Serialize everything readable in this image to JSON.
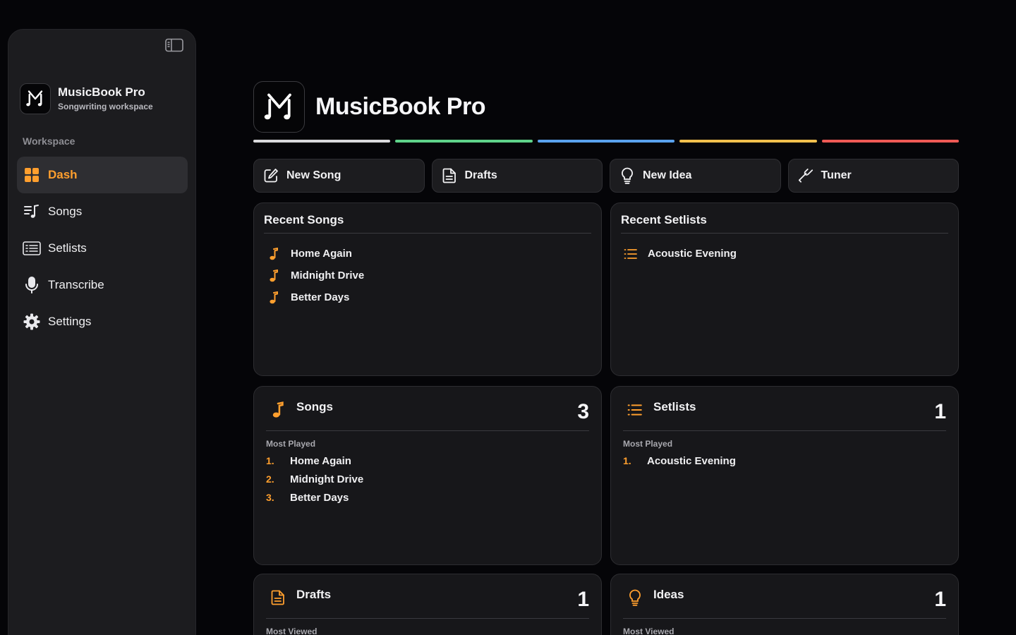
{
  "sidebar": {
    "brand_title": "MusicBook Pro",
    "brand_subtitle": "Songwriting workspace",
    "section_label": "Workspace",
    "items": [
      {
        "label": "Dash",
        "icon": "grid-icon",
        "active": true
      },
      {
        "label": "Songs",
        "icon": "music-list-icon"
      },
      {
        "label": "Setlists",
        "icon": "list-box-icon"
      },
      {
        "label": "Transcribe",
        "icon": "microphone-icon"
      },
      {
        "label": "Settings",
        "icon": "gear-icon"
      }
    ]
  },
  "header": {
    "title": "MusicBook Pro",
    "accent_colors": [
      "#d9d9dc",
      "#5fd38a",
      "#5aa2ee",
      "#f2c04d",
      "#ef5a55"
    ]
  },
  "actions": [
    {
      "label": "New Song",
      "icon": "compose-icon"
    },
    {
      "label": "Drafts",
      "icon": "document-icon"
    },
    {
      "label": "New Idea",
      "icon": "lightbulb-icon"
    },
    {
      "label": "Tuner",
      "icon": "tuning-fork-icon"
    }
  ],
  "recent_songs": {
    "title": "Recent Songs",
    "items": [
      "Home Again",
      "Midnight Drive",
      "Better Days"
    ]
  },
  "recent_setlists": {
    "title": "Recent Setlists",
    "items": [
      "Acoustic Evening"
    ]
  },
  "stats": {
    "songs": {
      "title": "Songs",
      "count": "3",
      "subtitle": "Most Played",
      "items": [
        {
          "rank": "1.",
          "name": "Home Again"
        },
        {
          "rank": "2.",
          "name": "Midnight Drive"
        },
        {
          "rank": "3.",
          "name": "Better Days"
        }
      ]
    },
    "setlists": {
      "title": "Setlists",
      "count": "1",
      "subtitle": "Most Played",
      "items": [
        {
          "rank": "1.",
          "name": "Acoustic Evening"
        }
      ]
    },
    "drafts": {
      "title": "Drafts",
      "count": "1",
      "subtitle": "Most Viewed"
    },
    "ideas": {
      "title": "Ideas",
      "count": "1",
      "subtitle": "Most Viewed"
    }
  },
  "colors": {
    "accent": "#ff9f2e",
    "background": "#050508",
    "card": "#17171a"
  }
}
